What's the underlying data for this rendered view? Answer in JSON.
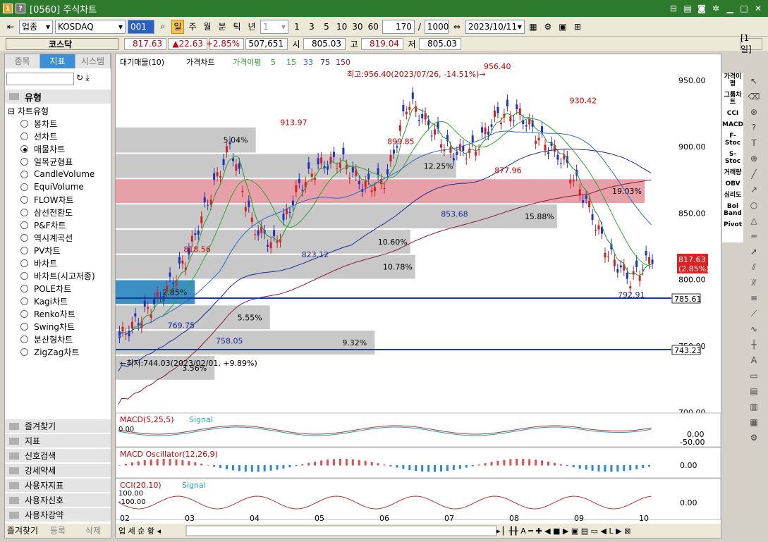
{
  "title": {
    "badge1": "1",
    "badge2": "?",
    "text": "[0560] 주식차트"
  },
  "toolbar": {
    "market": "업종",
    "code": "KOSDAQ",
    "code_box": "001",
    "period_btns": [
      "일",
      "주",
      "월",
      "분",
      "틱",
      "년"
    ],
    "interval": "1",
    "nums": [
      "1",
      "3",
      "5",
      "10",
      "30",
      "60"
    ],
    "count": "170",
    "total": "1000",
    "date": "2023/10/11"
  },
  "quote": {
    "name": "코스닥",
    "price": "817.63",
    "change": "▲22.63",
    "pct": "+2.85%",
    "volume": "507,651",
    "open_lab": "시",
    "open": "805.03",
    "high_lab": "고",
    "high": "819.04",
    "low_lab": "저",
    "low": "805.03",
    "period": "[1일]"
  },
  "left": {
    "tabs": [
      "종목",
      "지표",
      "시스템"
    ],
    "group": "유형",
    "root": "차트유형",
    "types": [
      "봉차트",
      "선차트",
      "매물차트",
      "일목균형표",
      "CandleVolume",
      "EquiVolume",
      "FLOW차트",
      "삼선전환도",
      "P&F차트",
      "역시계곡선",
      "PV차트",
      "바차트",
      "바차트(시고저종)",
      "POLE차트",
      "Kagi차트",
      "Renko차트",
      "Swing차트",
      "분산형차트",
      "ZigZag차트"
    ],
    "groups": [
      "즐겨찾기",
      "지표",
      "신호검색",
      "강세약세",
      "사용자지표",
      "사용자신호",
      "사용자강약"
    ],
    "bottom": [
      "즐겨찾기",
      "등록",
      "삭제"
    ]
  },
  "right_labels": [
    "가격이평",
    "그룹차트",
    "CCI",
    "MACD",
    "F-Stoc",
    "S-Stoc",
    "거래량",
    "OBV",
    "심리도",
    "Bol Band",
    "Pivot"
  ],
  "chart_data": {
    "type": "line",
    "legend": {
      "vol": "대기매물(10)",
      "price": "가격차트",
      "ma_title": "가격이평",
      "ma": [
        "5",
        "15",
        "33",
        "75",
        "150"
      ]
    },
    "x": [
      "02",
      "03",
      "04",
      "05",
      "06",
      "07",
      "08",
      "09",
      "10"
    ],
    "close": [
      756,
      772,
      790,
      815,
      860,
      902,
      840,
      826,
      868,
      886,
      890,
      870,
      875,
      935,
      915,
      895,
      898,
      924,
      925,
      905,
      890,
      860,
      820,
      800,
      817.63
    ],
    "ylim": [
      700,
      960
    ],
    "y_ticks": [
      "950.00",
      "900.00",
      "850.00",
      "800.00",
      "750.00",
      "700.00"
    ],
    "annotations": {
      "high": "최고:956.40(2023/07/26, -14.51%)→",
      "low": "←최저:744.03(2023/02/01, +9.89%)",
      "pts": [
        "956.40",
        "930.42",
        "913.97",
        "899.85",
        "877.96",
        "853.68",
        "823.12",
        "818.56",
        "769.75",
        "758.05",
        "792.91"
      ]
    },
    "vol_profile": [
      {
        "pct": "5.04%",
        "lo": 895,
        "hi": 915
      },
      {
        "pct": "12.25%",
        "lo": 876,
        "hi": 895
      },
      {
        "pct": "19.03%",
        "lo": 857,
        "hi": 876
      },
      {
        "pct": "15.88%",
        "lo": 838,
        "hi": 857
      },
      {
        "pct": "10.60%",
        "lo": 819,
        "hi": 838
      },
      {
        "pct": "10.78%",
        "lo": 800,
        "hi": 819
      },
      {
        "pct": "2.85%",
        "lo": 781,
        "hi": 800
      },
      {
        "pct": "5.55%",
        "lo": 762,
        "hi": 781
      },
      {
        "pct": "9.32%",
        "lo": 743,
        "hi": 762
      },
      {
        "pct": "3.56%",
        "lo": 724,
        "hi": 743
      }
    ],
    "lines": [
      "785.61",
      "743.23"
    ],
    "price_tag": "817.63",
    "price_tag2": "(2.85%)",
    "macd": {
      "title": "MACD(5,25,5)",
      "signal": "Signal",
      "y": [
        "0.00",
        "-50.00"
      ],
      "lab": "0.00"
    },
    "osc": {
      "title": "MACD Oscillator(12,26,9)",
      "y": "0.00"
    },
    "cci": {
      "title": "CCI(20,10)",
      "signal": "Signal",
      "y": "0.00",
      "labs": [
        "100.00",
        "-100.00"
      ]
    }
  }
}
